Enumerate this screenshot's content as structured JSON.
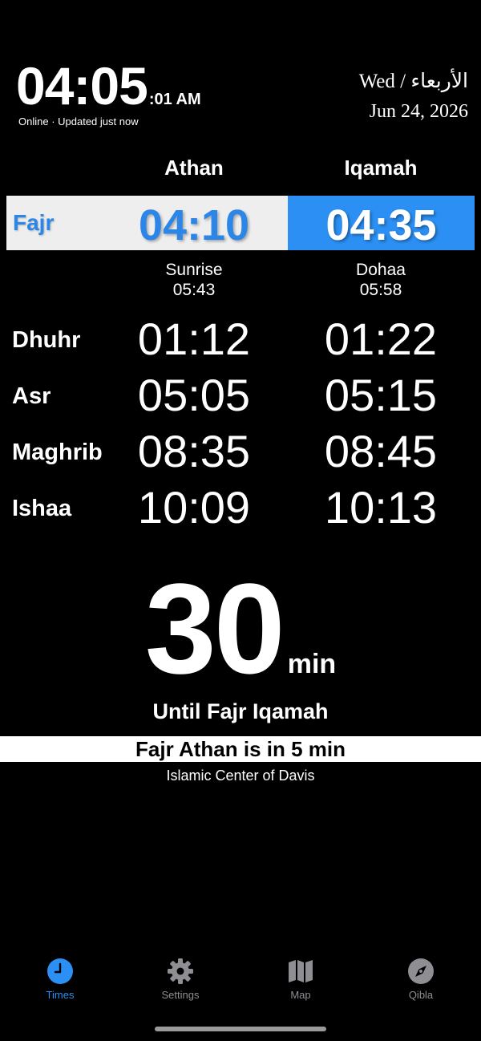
{
  "header": {
    "time_main": "04:05",
    "time_seconds_ampm": ":01 AM",
    "status": "Online · Updated just now",
    "weekday": "Wed / الأربعاء",
    "date": "Jun 24, 2026"
  },
  "columns": {
    "athan": "Athan",
    "iqamah": "Iqamah"
  },
  "highlight": {
    "name": "Fajr",
    "athan": "04:10",
    "iqamah": "04:35",
    "athan_bg": "#eeeeee",
    "athan_color": "#2b86e8",
    "iqamah_bg": "#2b8ff3"
  },
  "extra": {
    "sunrise_label": "Sunrise",
    "sunrise_time": "05:43",
    "dohaa_label": "Dohaa",
    "dohaa_time": "05:58"
  },
  "prayers": [
    {
      "name": "Dhuhr",
      "athan": "01:12",
      "iqamah": "01:22"
    },
    {
      "name": "Asr",
      "athan": "05:05",
      "iqamah": "05:15"
    },
    {
      "name": "Maghrib",
      "athan": "08:35",
      "iqamah": "08:45"
    },
    {
      "name": "Ishaa",
      "athan": "10:09",
      "iqamah": "10:13"
    }
  ],
  "countdown": {
    "value": "30",
    "unit": "min",
    "until": "Until Fajr Iqamah",
    "banner": "Fajr Athan is in 5 min",
    "mosque": "Islamic Center of Davis"
  },
  "tabs": [
    {
      "label": "Times",
      "icon": "clock-icon",
      "active": true
    },
    {
      "label": "Settings",
      "icon": "gear-icon",
      "active": false
    },
    {
      "label": "Map",
      "icon": "map-icon",
      "active": false
    },
    {
      "label": "Qibla",
      "icon": "compass-icon",
      "active": false
    }
  ],
  "colors": {
    "accent": "#2b8ff3",
    "inactive_tab": "#8e8e93",
    "background": "#000000"
  }
}
